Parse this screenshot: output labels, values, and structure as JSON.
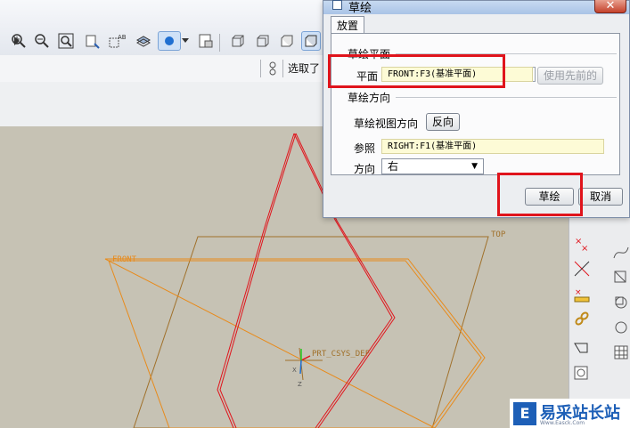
{
  "toolbar": {
    "selected_status": "选取了"
  },
  "dialog": {
    "title": "草绘",
    "close_glyph": "✕",
    "tab_label": "放置",
    "sketch_plane_group": "草绘平面",
    "plane_label": "平面",
    "plane_value": "FRONT:F3(基准平面)",
    "use_previous_button": "使用先前的",
    "sketch_orientation_group": "草绘方向",
    "view_direction_label": "草绘视图方向",
    "flip_button": "反向",
    "reference_label": "参照",
    "reference_value": "RIGHT:F1(基准平面)",
    "orientation_label": "方向",
    "orientation_value": "右",
    "sketch_button": "草绘",
    "cancel_button": "取消"
  },
  "canvas": {
    "front_plane_label": "FRONT",
    "top_plane_label": "TOP",
    "csys_label": "PRT_CSYS_DEF",
    "axis_x": "X",
    "axis_z": "Z"
  },
  "watermark": {
    "text": "易采站长站",
    "sub": "Www.Easck.Com",
    "logo_glyph": "E"
  },
  "colors": {
    "highlight": "#e0141c",
    "datum_orange": "#e88a1a",
    "datum_brown": "#a0702a",
    "sketch_red": "#e0141c",
    "canvas_bg": "#c6c2b4"
  },
  "icons": [
    "zoom-in-icon",
    "zoom-out-icon",
    "zoom-fit-icon",
    "reorient-icon",
    "datum-display-icon",
    "layers-icon",
    "saved-views-icon",
    "display-style-icon",
    "spin-center-icon",
    "sketch-icon"
  ]
}
